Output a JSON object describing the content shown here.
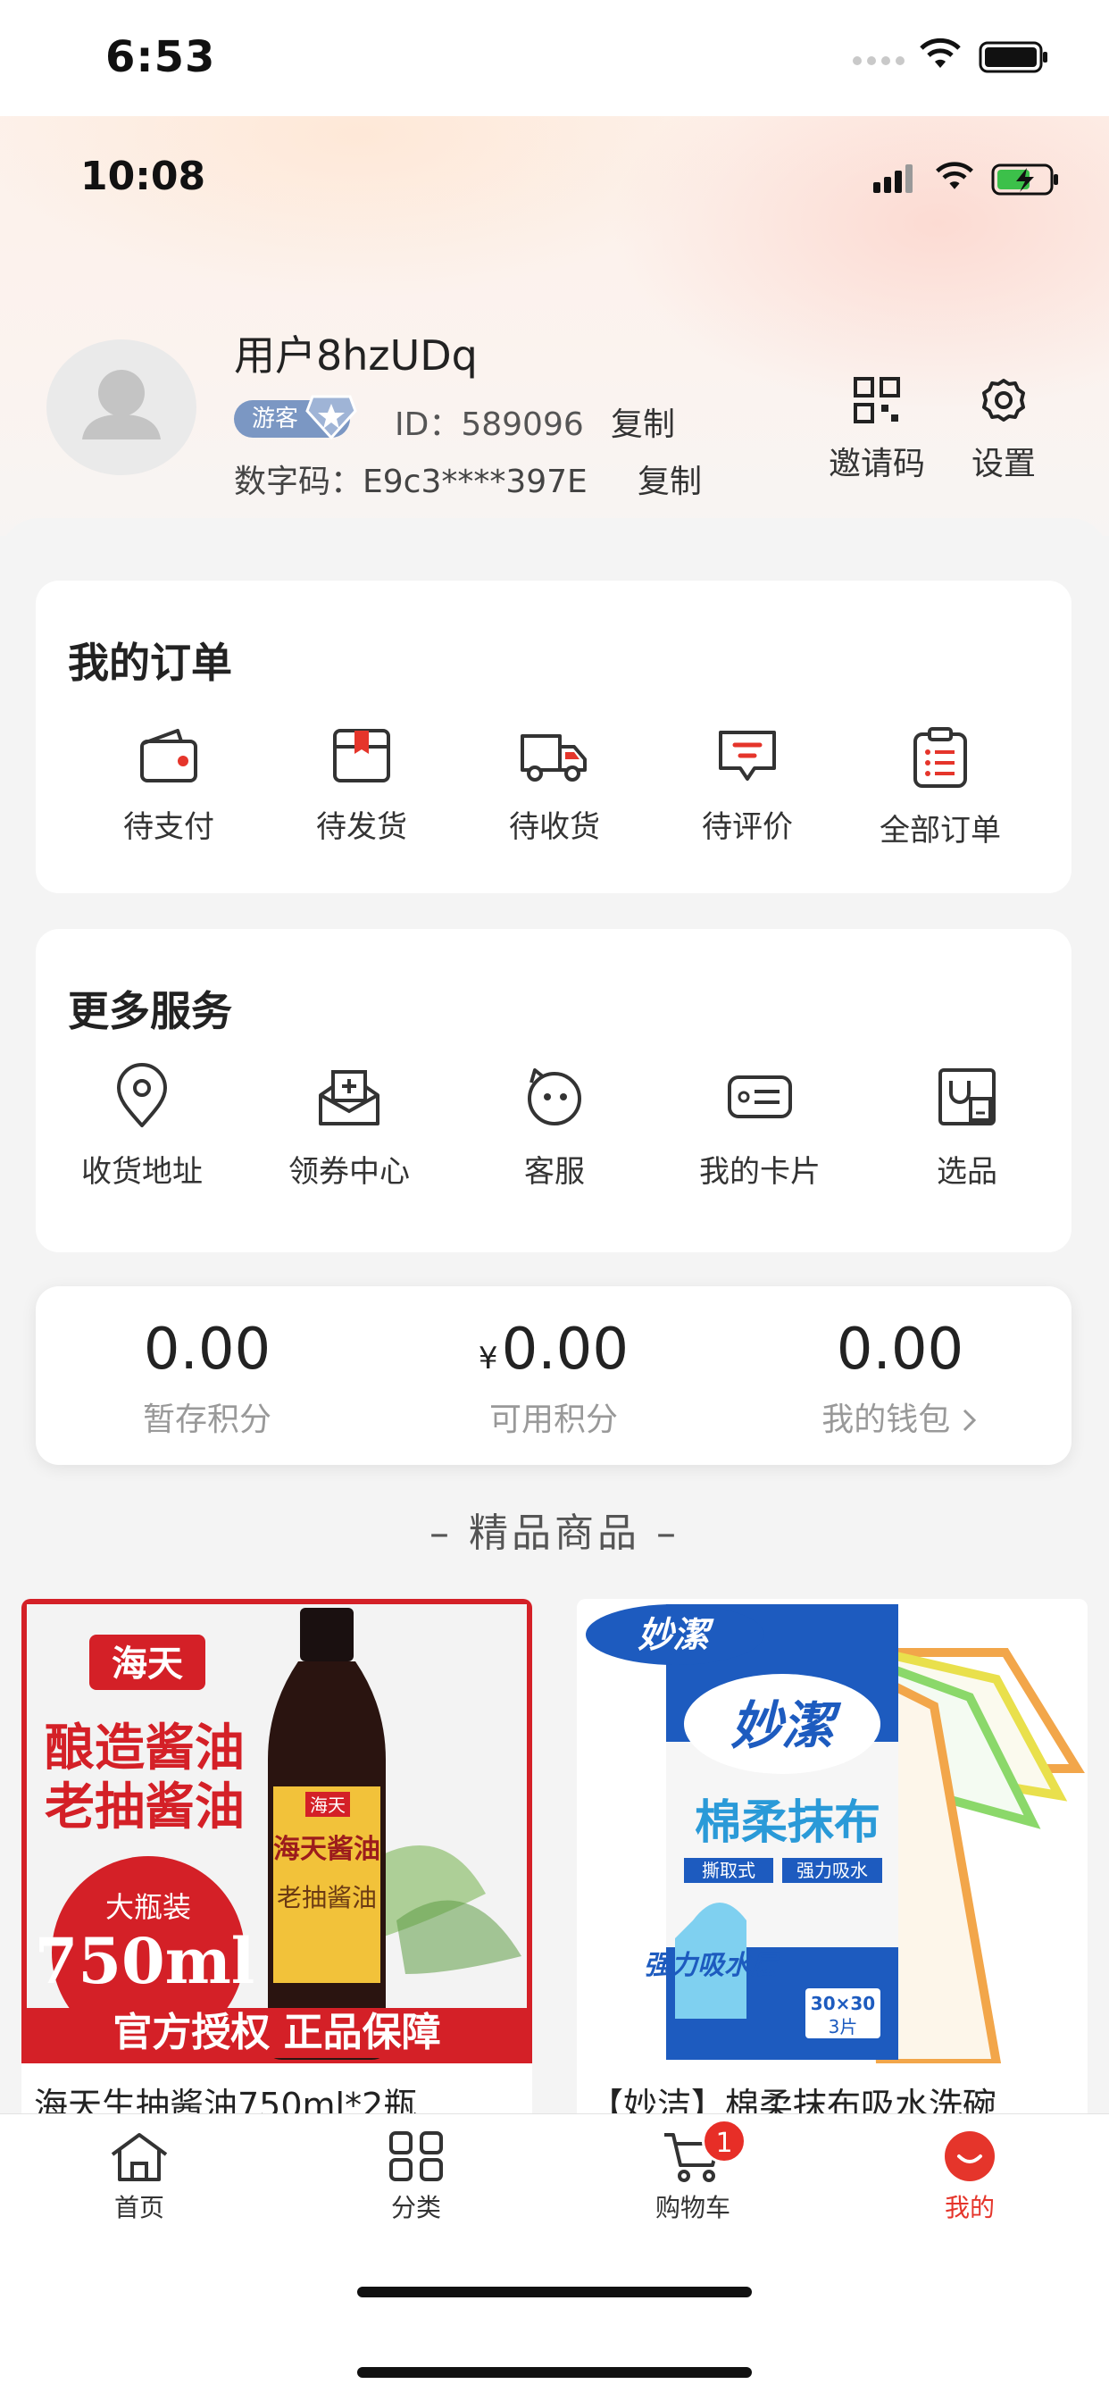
{
  "outer_status": {
    "time": "6:53"
  },
  "inner_status": {
    "time": "10:08"
  },
  "profile": {
    "username": "用户8hzUDq",
    "badge": "游客",
    "id_text": "ID：589096",
    "copy_label": "复制",
    "digital_code": "数字码：E9c3****397E",
    "copy_label_2": "复制"
  },
  "top_actions": [
    {
      "label": "邀请码",
      "icon": "qr-code-icon"
    },
    {
      "label": "设置",
      "icon": "gear-icon"
    }
  ],
  "orders": {
    "title": "我的订单",
    "items": [
      {
        "label": "待支付",
        "icon": "wallet-icon"
      },
      {
        "label": "待发货",
        "icon": "package-icon"
      },
      {
        "label": "待收货",
        "icon": "truck-icon"
      },
      {
        "label": "待评价",
        "icon": "review-icon"
      },
      {
        "label": "全部订单",
        "icon": "list-clipboard-icon"
      }
    ]
  },
  "services": {
    "title": "更多服务",
    "items": [
      {
        "label": "收货地址",
        "icon": "location-pin-icon"
      },
      {
        "label": "领券中心",
        "icon": "coupon-icon"
      },
      {
        "label": "客服",
        "icon": "customer-service-icon"
      },
      {
        "label": "我的卡片",
        "icon": "card-icon"
      },
      {
        "label": "选品",
        "icon": "select-product-icon"
      }
    ]
  },
  "points": [
    {
      "value": "0.00",
      "label": "暂存积分"
    },
    {
      "currency": "¥",
      "value": "0.00",
      "label": "可用积分"
    },
    {
      "value": "0.00",
      "label": "我的钱包"
    }
  ],
  "section_title": "– 精品商品 –",
  "products": [
    {
      "title": "海天生抽酱油750ml*2瓶",
      "image": {
        "brand": "海天",
        "line1": "酿造酱油",
        "line2": "老抽酱油",
        "size_label": "大瓶装",
        "size": "750ml",
        "banner": "官方授权 正品保障",
        "bottle_brand": "海天酱油",
        "bottle_name": "老抽酱油"
      }
    },
    {
      "title": "【妙洁】棉柔抹布吸水洗碗",
      "image": {
        "brand": "妙潔",
        "product": "棉柔抹布",
        "feature1": "撕取式",
        "feature2": "强力吸水",
        "badge": "强力吸水层",
        "size": "30×30",
        "count": "3片"
      }
    }
  ],
  "bottom_nav": [
    {
      "label": "首页",
      "icon": "home-icon"
    },
    {
      "label": "分类",
      "icon": "category-grid-icon"
    },
    {
      "label": "购物车",
      "icon": "cart-icon",
      "badge": "1"
    },
    {
      "label": "我的",
      "icon": "profile-face-icon",
      "active": true
    }
  ],
  "colors": {
    "accent": "#e5352b",
    "badge_blue": "#7b97c3"
  }
}
